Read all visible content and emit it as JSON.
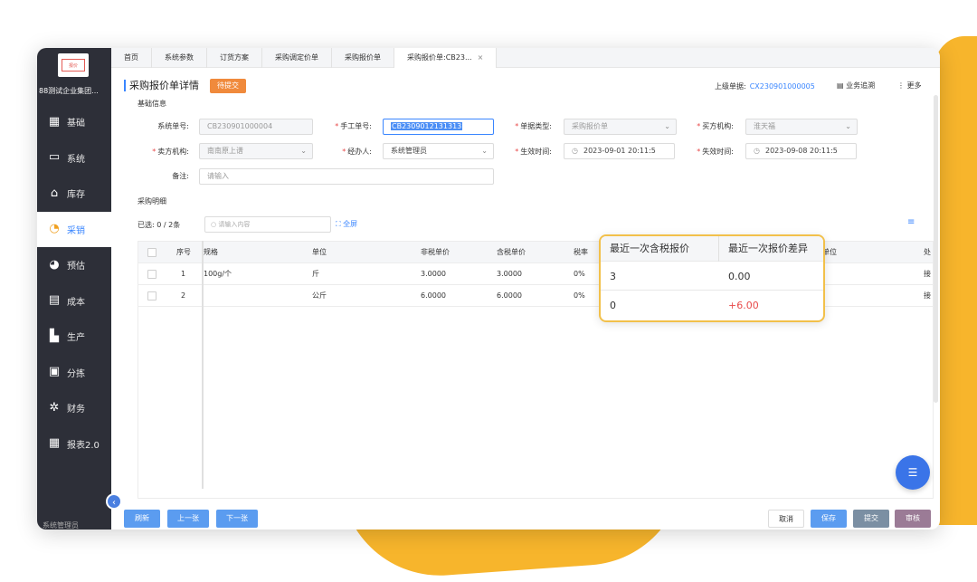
{
  "logo_text": "报价",
  "org_name": "88测试企业集团...",
  "nav": [
    {
      "label": "基础",
      "icon": "grid-icon"
    },
    {
      "label": "系统",
      "icon": "monitor-icon"
    },
    {
      "label": "库存",
      "icon": "warehouse-icon"
    },
    {
      "label": "采销",
      "icon": "cycle-icon"
    },
    {
      "label": "预估",
      "icon": "gauge-icon"
    },
    {
      "label": "成本",
      "icon": "coins-icon"
    },
    {
      "label": "生产",
      "icon": "factory-icon"
    },
    {
      "label": "分拣",
      "icon": "sort-icon"
    },
    {
      "label": "财务",
      "icon": "finance-icon"
    },
    {
      "label": "报表2.0",
      "icon": "report-icon"
    }
  ],
  "sidebar_foot": "系统管理员",
  "tabs": [
    "首页",
    "系统参数",
    "订货方案",
    "采购调定价单",
    "采购报价单",
    "采购报价单:CB23..."
  ],
  "tab_close": "×",
  "header": {
    "title": "采购报价单详情",
    "status": "待提交",
    "upper_label": "上级单据:",
    "upper_value": "CX230901000005",
    "trace": "业务追溯",
    "more": "更多"
  },
  "section_basic": "基础信息",
  "form": {
    "sys_no_label": "系统单号:",
    "sys_no": "CB230901000004",
    "manual_no_label": "手工单号:",
    "manual_no": "CB2309012131313",
    "doc_type_label": "单据类型:",
    "doc_type": "采购报价单",
    "buyer_label": "买方机构:",
    "buyer": "淮天福",
    "seller_label": "卖方机构:",
    "seller": "南南原上谱",
    "handler_label": "经办人:",
    "handler": "系统管理员",
    "effective_label": "生效时间:",
    "effective": "2023-09-01 20:11:5",
    "expire_label": "失效时间:",
    "expire": "2023-09-08 20:11:5",
    "remark_label": "备注:",
    "remark_placeholder": "请输入"
  },
  "section_detail": "采购明细",
  "toolbar": {
    "selected": "已选: 0 / 2条",
    "search_placeholder": "请输入内容",
    "fullscreen": "全屏"
  },
  "table": {
    "headers": [
      "序号",
      "规格",
      "单位",
      "非税单价",
      "含税单价",
      "税率",
      "单位",
      "处"
    ],
    "rows": [
      {
        "no": "1",
        "spec": "100g/个",
        "unit": "斤",
        "price_ex": "3.0000",
        "price_in": "3.0000",
        "tax": "0%",
        "act": "接"
      },
      {
        "no": "2",
        "spec": "",
        "unit": "公斤",
        "price_ex": "6.0000",
        "price_in": "6.0000",
        "tax": "0%",
        "act": "接"
      }
    ]
  },
  "popup": {
    "h1": "最近一次含税报价",
    "h2": "最近一次报价差异",
    "rows": [
      {
        "last_price": "3",
        "diff": "0.00"
      },
      {
        "last_price": "0",
        "diff": "+6.00"
      }
    ]
  },
  "buttons": {
    "refresh": "刷新",
    "prev": "上一张",
    "next": "下一张",
    "cancel": "取消",
    "save": "保存",
    "submit": "提交",
    "audit": "审核"
  },
  "colors": {
    "accent": "#3a86ff",
    "status": "#f08a3c",
    "highlight": "#f2c04a",
    "negative": "#e84a4a"
  }
}
